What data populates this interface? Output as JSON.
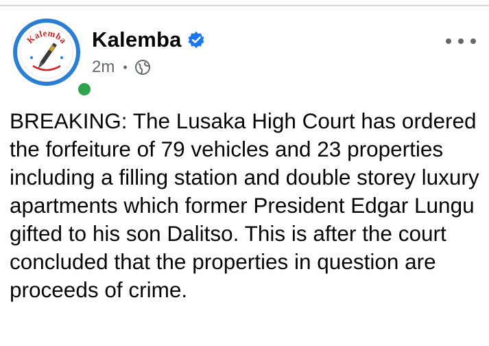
{
  "post": {
    "author": "Kalemba",
    "verified": true,
    "time": "2m",
    "separator": "•",
    "audience_icon": "globe-icon",
    "more_icon": "more-options-icon",
    "logo_text": "Kalemba",
    "text": "BREAKING: The Lusaka High Court has ordered the forfeiture of 79 vehicles and 23 properties including a filling station and double storey luxury apartments which former President Edgar Lungu gifted to his son Dalitso. This is after the court concluded that the properties in question are proceeds of crime."
  },
  "colors": {
    "verified_blue": "#1877f2",
    "online_green": "#31a24c",
    "logo_ring_blue": "#2a7fd4",
    "logo_red": "#d62020",
    "meta_gray": "#65676b"
  }
}
